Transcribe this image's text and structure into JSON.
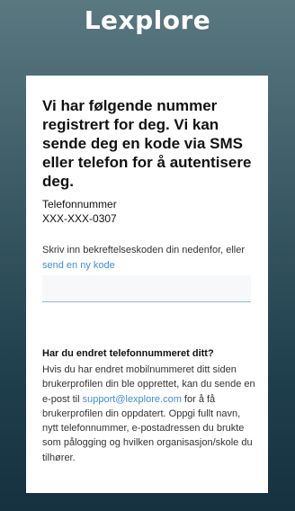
{
  "brand": {
    "logo_text": "Lexplore"
  },
  "card": {
    "heading": "Vi har følgende nummer registrert for deg. Vi kan sende deg en kode via SMS eller telefon for å autentisere deg.",
    "phone_label": "Telefonnummer",
    "phone_value": "XXX-XXX-0307",
    "instruction_text": "Skriv inn bekreftelseskoden din nedenfor, eller",
    "resend_link": "send en ny kode",
    "code_input": {
      "value": "",
      "placeholder": ""
    },
    "question_title": "Har du endret telefonnummeret ditt?",
    "question_body_before": "Hvis du har endret mobilnummeret ditt siden brukerprofilen din ble opprettet, kan du sende en e-post til",
    "support_email": "support@lexplore.com",
    "question_body_after": "for å få brukerprofilen din oppdatert. Oppgi fullt navn, nytt telefonnummer, e-postadressen du brukte som pålogging og hvilken organisasjon/skole du tilhører."
  },
  "colors": {
    "link": "#3f8fd8",
    "background_top": "#5a7880",
    "background_bottom": "#16313f"
  }
}
